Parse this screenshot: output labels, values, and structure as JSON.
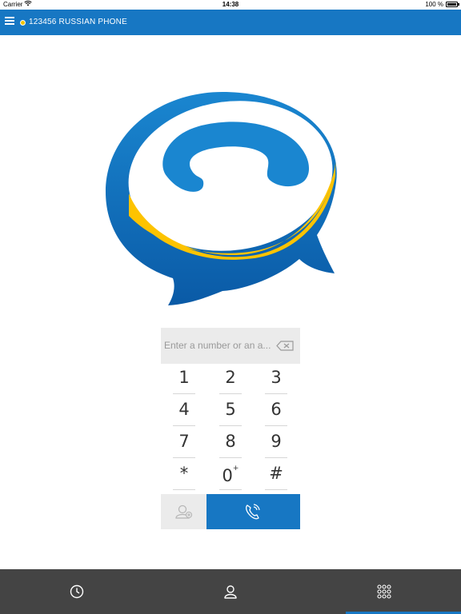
{
  "status_bar": {
    "carrier": "Carrier",
    "wifi_icon": "wifi-icon",
    "time": "14:38",
    "battery": "100 %",
    "battery_icon": "battery-icon"
  },
  "app_bar": {
    "menu_icon": "hamburger-menu-icon",
    "status_color": "#f5c400",
    "account_title": "123456 RUSSIAN PHONE",
    "background_color": "#1777c3"
  },
  "logo": {
    "icon": "phone-bubble-logo",
    "colors": {
      "blue": "#1777c3",
      "dark_blue": "#0c5fa8",
      "yellow": "#fdc300"
    }
  },
  "dialer": {
    "input_value": "",
    "input_placeholder": "Enter a number or an a...",
    "backspace_icon": "backspace-icon",
    "keys": [
      {
        "label": "1",
        "sub": ""
      },
      {
        "label": "2",
        "sub": ""
      },
      {
        "label": "3",
        "sub": ""
      },
      {
        "label": "4",
        "sub": ""
      },
      {
        "label": "5",
        "sub": ""
      },
      {
        "label": "6",
        "sub": ""
      },
      {
        "label": "7",
        "sub": ""
      },
      {
        "label": "8",
        "sub": ""
      },
      {
        "label": "9",
        "sub": ""
      },
      {
        "label": "*",
        "sub": ""
      },
      {
        "label": "0",
        "sub": "+"
      },
      {
        "label": "#",
        "sub": ""
      }
    ],
    "add_contact_icon": "add-contact-icon",
    "call_icon": "phone-call-icon"
  },
  "tab_bar": {
    "tabs": [
      {
        "icon": "history-clock-icon",
        "active": false
      },
      {
        "icon": "contacts-person-icon",
        "active": false
      },
      {
        "icon": "keypad-grid-icon",
        "active": true
      }
    ],
    "background_color": "#444444"
  }
}
